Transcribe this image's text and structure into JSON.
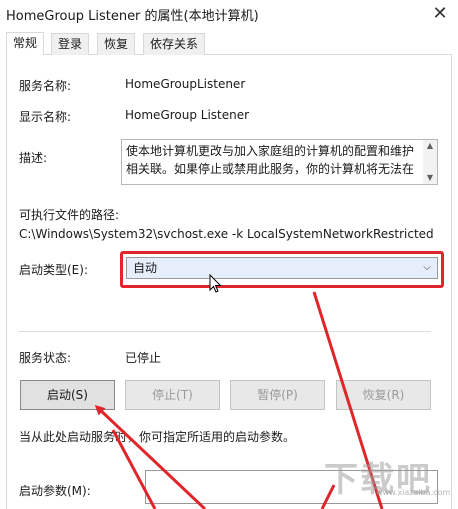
{
  "window": {
    "title": "HomeGroup Listener 的属性(本地计算机)",
    "close_glyph": "✕"
  },
  "tabs": [
    {
      "label": "常规",
      "active": true
    },
    {
      "label": "登录",
      "active": false
    },
    {
      "label": "恢复",
      "active": false
    },
    {
      "label": "依存关系",
      "active": false
    }
  ],
  "general": {
    "service_name_label": "服务名称:",
    "service_name_value": "HomeGroupListener",
    "display_name_label": "显示名称:",
    "display_name_value": "HomeGroup Listener",
    "description_label": "描述:",
    "description_text": "使本地计算机更改与加入家庭组的计算机的配置和维护相关联。如果停止或禁用此服务，你的计算机将无法在",
    "exe_path_label": "可执行文件的路径:",
    "exe_path_value": "C:\\Windows\\System32\\svchost.exe -k LocalSystemNetworkRestricted",
    "startup_type_label": "启动类型(E):",
    "startup_type_value": "自动",
    "service_status_label": "服务状态:",
    "service_status_value": "已停止",
    "buttons": {
      "start": "启动(S)",
      "stop": "停止(T)",
      "pause": "暂停(P)",
      "resume": "恢复(R)"
    },
    "hint_text": "当从此处启动服务时，你可指定所适用的启动参数。",
    "start_params_label": "启动参数(M):",
    "start_params_value": ""
  },
  "annotation": {
    "highlight_color": "#e0262a",
    "arrow_color": "#e0262a"
  },
  "watermark": {
    "text": "下载吧",
    "url": "www.xiazaiba.com"
  },
  "icons": [
    "close-icon",
    "chevron-down-icon",
    "scroll-up-icon",
    "scroll-down-icon",
    "mouse-cursor-icon"
  ]
}
